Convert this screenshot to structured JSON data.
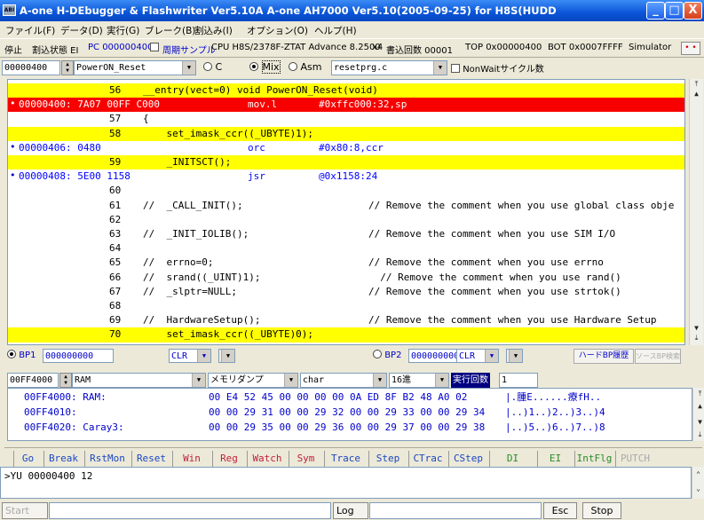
{
  "title": "A-one H-DEbugger & Flashwriter Ver5.10A A-one AH7000 Ver5.10(2005-09-25) for H8S(HUDD",
  "window_buttons": {
    "minimize": "_",
    "maximize": "□",
    "close": "X"
  },
  "app_icon_text": "ABI",
  "menu": [
    "ファイル(F)",
    "データ(D)",
    "実行(G)",
    "ブレーク(B)",
    "割込み(I)",
    "オプション(O)",
    "ヘルプ(H)"
  ],
  "status": {
    "state": "停止",
    "interrupt": "割込状態 EI",
    "pc": "PC 000000400",
    "periodic_sample": "周期サンプル",
    "cpu": "CPU H8S/2378F-ZTAT Advance 8.2500",
    "multiplier": "x4",
    "write_count": "書込回数 00001",
    "top": "TOP 0x00000400",
    "bot": "BOT 0x0007FFFF",
    "sim": "Simulator",
    "red_button": "• •"
  },
  "toolbar": {
    "address": "00000400",
    "function": "PowerON_Reset",
    "mode_c": "C",
    "mode_mix": "Mix",
    "mode_asm": "Asm",
    "file": "resetprg.c",
    "nonwait": "NonWaitサイクル数"
  },
  "code_lines": [
    {
      "kind": "src",
      "hl": "yellow",
      "num": "56",
      "text": "__entry(vect=0) void PowerON_Reset(void)"
    },
    {
      "kind": "asm",
      "hl": "red",
      "addr": "00000400: 7A07 00FF C000",
      "op": "mov.l",
      "args": "#0xffc000:32,sp"
    },
    {
      "kind": "src",
      "hl": "",
      "num": "57",
      "text": "{"
    },
    {
      "kind": "src",
      "hl": "yellow",
      "num": "58",
      "text": "    set_imask_ccr((_UBYTE)1);"
    },
    {
      "kind": "asm",
      "hl": "",
      "addr": "00000406: 0480",
      "op": "orc",
      "args": "#0x80:8,ccr"
    },
    {
      "kind": "src",
      "hl": "yellow",
      "num": "59",
      "text": "    _INITSCT();"
    },
    {
      "kind": "asm",
      "hl": "",
      "addr": "00000408: 5E00 1158",
      "op": "jsr",
      "args": "@0x1158:24"
    },
    {
      "kind": "src",
      "hl": "",
      "num": "60",
      "text": ""
    },
    {
      "kind": "src",
      "hl": "",
      "num": "61",
      "text": "//  _CALL_INIT();",
      "comment": "// Remove the comment when you use global class obje"
    },
    {
      "kind": "src",
      "hl": "",
      "num": "62",
      "text": ""
    },
    {
      "kind": "src",
      "hl": "",
      "num": "63",
      "text": "//  _INIT_IOLIB();",
      "comment": "// Remove the comment when you use SIM I/O"
    },
    {
      "kind": "src",
      "hl": "",
      "num": "64",
      "text": ""
    },
    {
      "kind": "src",
      "hl": "",
      "num": "65",
      "text": "//  errno=0;",
      "comment": "// Remove the comment when you use errno"
    },
    {
      "kind": "src",
      "hl": "",
      "num": "66",
      "text": "//  srand((_UINT)1);",
      "comment": "  // Remove the comment when you use rand()"
    },
    {
      "kind": "src",
      "hl": "",
      "num": "67",
      "text": "//  _slptr=NULL;",
      "comment": "// Remove the comment when you use strtok()"
    },
    {
      "kind": "src",
      "hl": "",
      "num": "68",
      "text": ""
    },
    {
      "kind": "src",
      "hl": "",
      "num": "69",
      "text": "//  HardwareSetup();",
      "comment": "// Remove the comment when you use Hardware Setup"
    },
    {
      "kind": "src",
      "hl": "yellow",
      "num": "70",
      "text": "    set_imask_ccr((_UBYTE)0);"
    }
  ],
  "bp": {
    "bp1_label": "BP1",
    "bp1_value": "000000000",
    "bp1_clr": "CLR",
    "bp2_label": "BP2",
    "bp2_value": "000000000",
    "bp2_clr": "CLR",
    "hw_history": "ハードBP履歴",
    "src_search": "ソースBP検索"
  },
  "mem_toolbar": {
    "address": "00FF4000",
    "area": "RAM",
    "view": "メモリダンプ",
    "type": "char",
    "radix": "16進",
    "exec_count_label": "実行回数",
    "exec_count": "1"
  },
  "memory": [
    {
      "addr": "00FF4000: RAM:",
      "hex": "00 E4 52 45 00 00 00 00 0A ED 8F B2 48 A0 02",
      "chars": "|.腫E......療fH.."
    },
    {
      "addr": "00FF4010:",
      "hex": "00 00 29 31 00 00 29 32 00 00 29 33 00 00 29 34",
      "chars": "|..)1..)2..)3..)4"
    },
    {
      "addr": "00FF4020: Caray3:",
      "hex": "00 00 29 35 00 00 29 36 00 00 29 37 00 00 29 38",
      "chars": "|..)5..)6..)7..)8"
    }
  ],
  "commands": [
    "Go",
    "Break",
    "RstMon",
    "Reset",
    "Win",
    "Reg",
    "Watch",
    "Sym",
    "Trace",
    "Step",
    "CTrac",
    "CStep",
    "DI",
    "EI",
    "IntFlg",
    "PUTCH"
  ],
  "console_text": ">YU 00000400 12",
  "bottom": {
    "start": "Start",
    "log": "Log",
    "esc": "Esc",
    "stop": "Stop"
  }
}
